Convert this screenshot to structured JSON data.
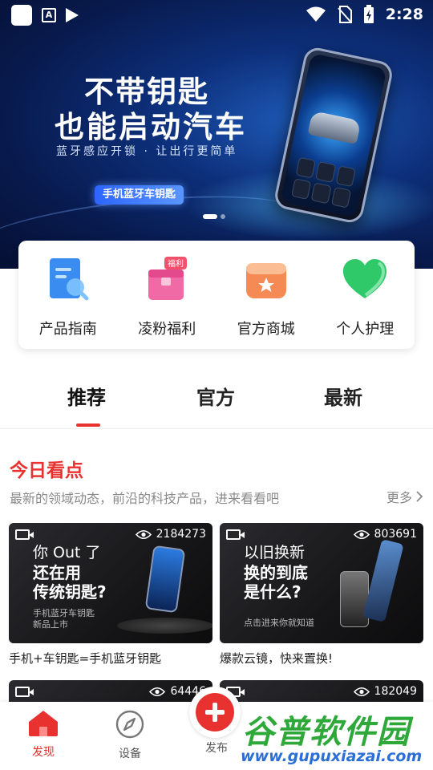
{
  "status_bar": {
    "time": "2:28"
  },
  "banner": {
    "title_line1": "不带钥匙",
    "title_line2": "也能启动汽车",
    "subtitle": "蓝牙感应开锁 · 让出行更简单",
    "tag": "手机蓝牙车钥匙",
    "page_count": 2,
    "active_page": 1
  },
  "quick_links": [
    {
      "label": "产品指南",
      "icon": "guide-icon",
      "color": "#3a8cf0"
    },
    {
      "label": "凌粉福利",
      "icon": "gift-icon",
      "badge": "福利",
      "color": "#ef4f8c"
    },
    {
      "label": "官方商城",
      "icon": "store-icon",
      "color": "#f26a3a"
    },
    {
      "label": "个人护理",
      "icon": "heart-icon",
      "color": "#2fc96a"
    }
  ],
  "tabs": [
    {
      "label": "推荐",
      "active": true
    },
    {
      "label": "官方",
      "active": false
    },
    {
      "label": "最新",
      "active": false
    }
  ],
  "section": {
    "title": "今日看点",
    "subtitle": "最新的领域动态，前沿的科技产品，进来看看吧",
    "more_label": "更多"
  },
  "videos": [
    {
      "views": "2184273",
      "headline1": "你 Out 了",
      "headline2": "还在用",
      "headline3": "传统钥匙?",
      "small": "手机蓝牙车钥匙",
      "small2": "新品上市",
      "caption": "手机+车钥匙=手机蓝牙钥匙"
    },
    {
      "views": "803691",
      "headline1": "以旧换新",
      "headline2": "换的到底",
      "headline3": "是什么?",
      "small": "点击进来你就知道",
      "caption": "爆款云镜，快来置换!"
    },
    {
      "views": "64446"
    },
    {
      "views": "182049"
    }
  ],
  "bottom_nav": {
    "discover": "发现",
    "devices": "设备",
    "publish": "发布"
  },
  "watermark": {
    "title": "谷普软件园",
    "url": "www.gupuxiazai.com"
  },
  "colors": {
    "accent": "#e8322f",
    "watermark_green": "#2fa83a",
    "watermark_blue": "#2b6fd6"
  }
}
